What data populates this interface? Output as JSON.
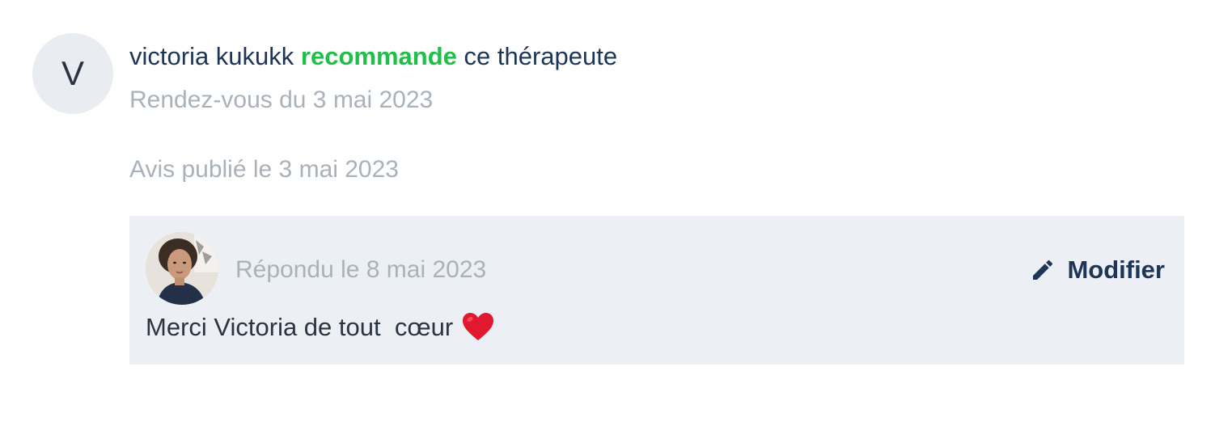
{
  "review": {
    "avatar_initial": "V",
    "author": "victoria kukukk",
    "recommend_word": "recommande",
    "headline_suffix": "ce thérapeute",
    "appointment_text": "Rendez-vous du 3 mai 2023",
    "published_text": "Avis publié le 3 mai 2023"
  },
  "reply": {
    "date_text": "Répondu le 8 mai 2023",
    "edit_label": "Modifier",
    "edit_icon": "pencil-icon",
    "message": "Merci Victoria de tout  cœur",
    "emoji_icon": "red-heart-icon"
  },
  "colors": {
    "primary_text": "#1e3558",
    "recommend_green": "#1fbf4a",
    "muted_text": "#a9b1ba",
    "reply_bg": "#ecf0f4",
    "avatar_bg": "#e9edf1"
  }
}
